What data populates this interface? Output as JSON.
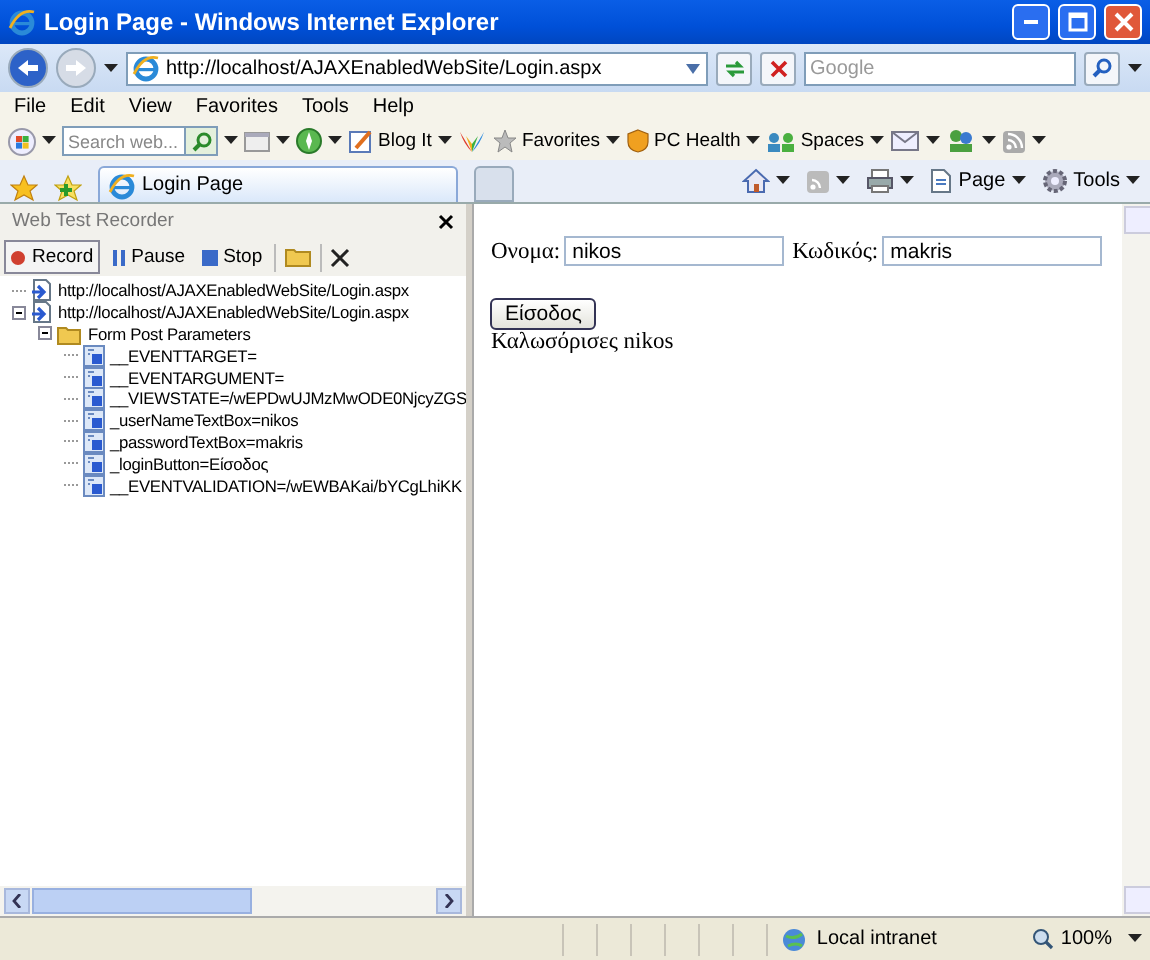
{
  "window": {
    "title": "Login Page - Windows Internet Explorer"
  },
  "address_bar": {
    "url": "http://localhost/AJAXEnabledWebSite/Login.aspx",
    "search_placeholder": "Google"
  },
  "menu": [
    "File",
    "Edit",
    "View",
    "Favorites",
    "Tools",
    "Help"
  ],
  "links_toolbar": {
    "search_placeholder": "Search web...",
    "items": [
      {
        "kind": "blog",
        "label": "Blog It"
      },
      {
        "kind": "butterfly"
      },
      {
        "kind": "favorites",
        "label": "Favorites"
      },
      {
        "kind": "health",
        "label": "PC Health"
      },
      {
        "kind": "spaces",
        "label": "Spaces"
      },
      {
        "kind": "mail"
      },
      {
        "kind": "people"
      },
      {
        "kind": "feed"
      }
    ]
  },
  "tabs": [
    {
      "label": "Login Page",
      "selected": true
    }
  ],
  "command_bar": [
    "Page",
    "Tools"
  ],
  "recorder": {
    "title": "Web Test Recorder",
    "buttons": [
      {
        "kind": "record",
        "label": "Record"
      },
      {
        "kind": "pause",
        "label": "Pause"
      },
      {
        "kind": "stop",
        "label": "Stop"
      }
    ],
    "tree": [
      {
        "kind": "request",
        "label": "http://localhost/AJAXEnabledWebSite/Login.aspx"
      },
      {
        "kind": "request",
        "label": "http://localhost/AJAXEnabledWebSite/Login.aspx",
        "expanded": true,
        "children": [
          {
            "kind": "folder",
            "label": "Form Post Parameters",
            "expanded": true,
            "children": [
              {
                "kind": "param",
                "label": "__EVENTTARGET="
              },
              {
                "kind": "param",
                "label": "__EVENTARGUMENT="
              },
              {
                "kind": "param",
                "label": "__VIEWSTATE=/wEPDwUJMzMwODE0NjcyZGS"
              },
              {
                "kind": "param",
                "label": "_userNameTextBox=nikos"
              },
              {
                "kind": "param",
                "label": "_passwordTextBox=makris"
              },
              {
                "kind": "param",
                "label": "_loginButton=Είσοδος"
              },
              {
                "kind": "param",
                "label": "__EVENTVALIDATION=/wEWBAKai/bYCgLhiKK"
              }
            ]
          }
        ]
      }
    ]
  },
  "page": {
    "username_label": "Ονομα:",
    "username_value": "nikos",
    "password_label": "Κωδικός:",
    "password_value": "makris",
    "login_button": "Είσοδος",
    "welcome": "Καλωσόρισες nikos"
  },
  "status_bar": {
    "zone": "Local intranet",
    "zoom": "100%"
  }
}
